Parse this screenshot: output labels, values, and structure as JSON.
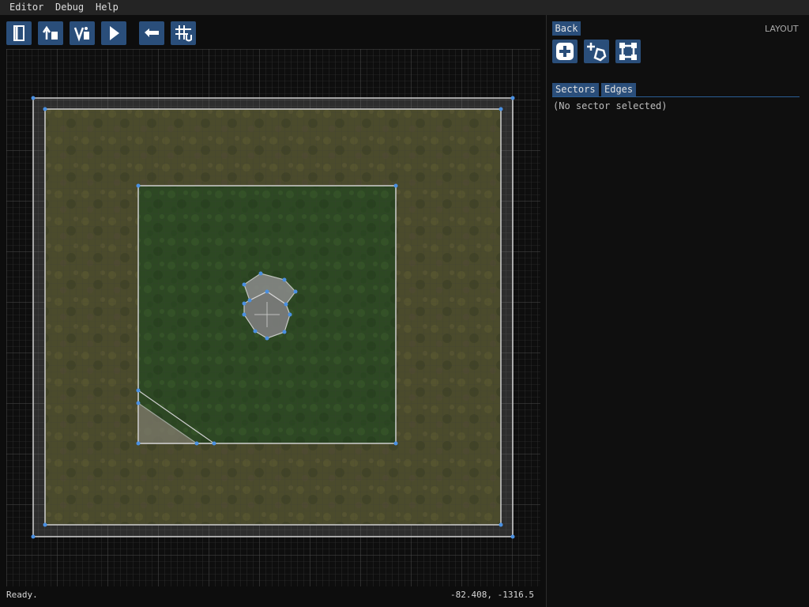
{
  "menubar": {
    "items": [
      {
        "label": "Editor"
      },
      {
        "label": "Debug"
      },
      {
        "label": "Help"
      }
    ]
  },
  "toolbar": {
    "icons": [
      "exit-door-icon",
      "load-up-icon",
      "save-file-icon",
      "play-icon",
      "undo-icon",
      "grid-snap-icon"
    ]
  },
  "viewport": {
    "status_text": "Ready.",
    "cursor_coords": "-82.408, -1316.5"
  },
  "panel": {
    "back_label": "Back",
    "mode_label": "LAYOUT",
    "tools": [
      "add-sector-icon",
      "add-polygon-icon",
      "select-vertices-icon"
    ],
    "tabs": [
      {
        "label": "Sectors"
      },
      {
        "label": "Edges"
      }
    ],
    "empty_message": "(No sector selected)"
  },
  "colors": {
    "accent": "#2a4e7a",
    "vertex": "#4a90e2",
    "edge": "#c8c8c8",
    "outer_terrain": "#4a4a2a",
    "inner_terrain": "#2e4a22"
  }
}
